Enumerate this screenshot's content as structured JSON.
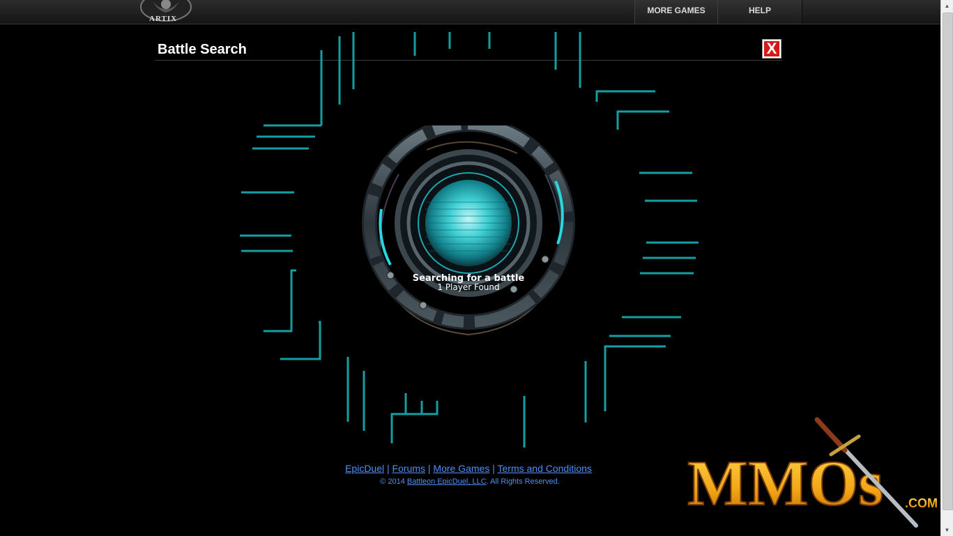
{
  "header": {
    "logo_text": "ARTIX",
    "nav": [
      {
        "label": "MORE GAMES"
      },
      {
        "label": "HELP"
      }
    ]
  },
  "dialog": {
    "title": "Battle Search",
    "close_label": "X"
  },
  "status": {
    "main": "Searching for a battle",
    "sub": "1 Player Found"
  },
  "footer": {
    "links": [
      "EpicDuel",
      "Forums",
      "More Games",
      "Terms and Conditions"
    ],
    "separator": "|",
    "copyright_prefix": "© 2014",
    "company_link": "Battleon EpicDuel, LLC",
    "copyright_suffix": ". All Rights Reserved."
  },
  "watermark": {
    "text": "MMOs",
    "suffix": ".COM"
  },
  "colors": {
    "accent_teal": "#14a3a6",
    "link_blue": "#4e8ff5",
    "close_red": "#d51a1a"
  }
}
